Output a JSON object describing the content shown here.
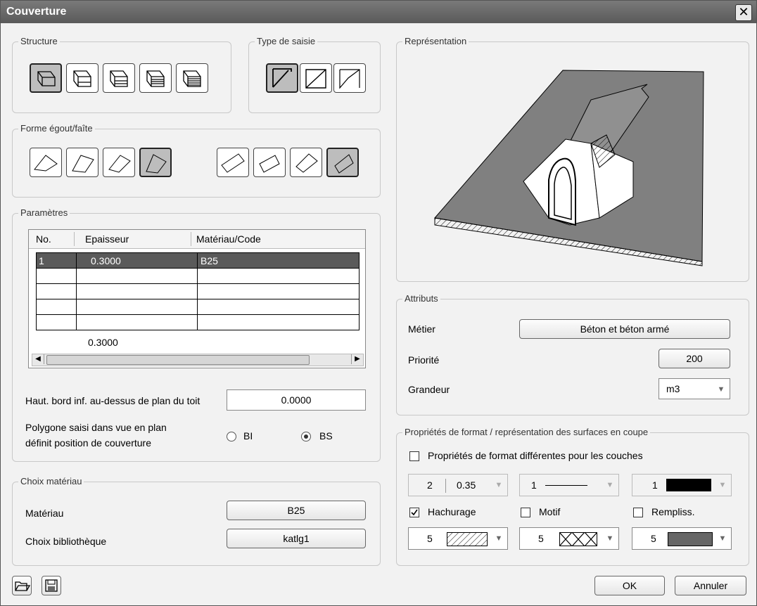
{
  "window": {
    "title": "Couverture",
    "close_icon": "close-icon"
  },
  "structure": {
    "title": "Structure",
    "buttons": [
      "layer-1-icon",
      "layer-2-icon",
      "layer-3-icon",
      "layer-4-icon",
      "layer-5-icon"
    ]
  },
  "type_saisie": {
    "title": "Type de saisie",
    "buttons": [
      "roof-slope-a-icon",
      "roof-slope-b-icon",
      "roof-slope-c-icon"
    ]
  },
  "forme": {
    "title": "Forme égout/faîte"
  },
  "parametres": {
    "title": "Paramètres",
    "columns": [
      "No.",
      "Epaisseur",
      "Matériau/Code"
    ],
    "rows": [
      [
        "1",
        "0.3000",
        "B25"
      ],
      [
        "",
        "",
        ""
      ],
      [
        "",
        "",
        ""
      ],
      [
        "",
        "",
        ""
      ],
      [
        "",
        "",
        ""
      ]
    ],
    "total": "0.3000",
    "haut_label": "Haut. bord inf. au-dessus de plan du toit",
    "haut_value": "0.0000",
    "poly_label_1": "Polygone saisi dans vue en plan",
    "poly_label_2": "définit position de couverture",
    "radio_bi": "BI",
    "radio_bs": "BS",
    "selected": "BS"
  },
  "choix": {
    "title": "Choix matériau",
    "materiau_label": "Matériau",
    "materiau_value": "B25",
    "biblio_label": "Choix bibliothèque",
    "biblio_value": "katlg1"
  },
  "representation": {
    "title": "Représentation"
  },
  "attributs": {
    "title": "Attributs",
    "metier_label": "Métier",
    "metier_value": "Béton et béton armé",
    "priorite_label": "Priorité",
    "priorite_value": "200",
    "grandeur_label": "Grandeur",
    "grandeur_value": "m3"
  },
  "format": {
    "title": "Propriétés de format / représentation des surfaces en coupe",
    "diff_label": "Propriétés de format différentes pour les couches",
    "pen_1": "2",
    "pen_2": "0.35",
    "line_type": "1",
    "color": "1",
    "hachurage_label": "Hachurage",
    "motif_label": "Motif",
    "rempliss_label": "Rempliss.",
    "hach_value": "5",
    "motif_value": "5",
    "rempliss_value": "5",
    "hachurage_checked": true
  },
  "footer": {
    "ok": "OK",
    "annuler": "Annuler"
  }
}
